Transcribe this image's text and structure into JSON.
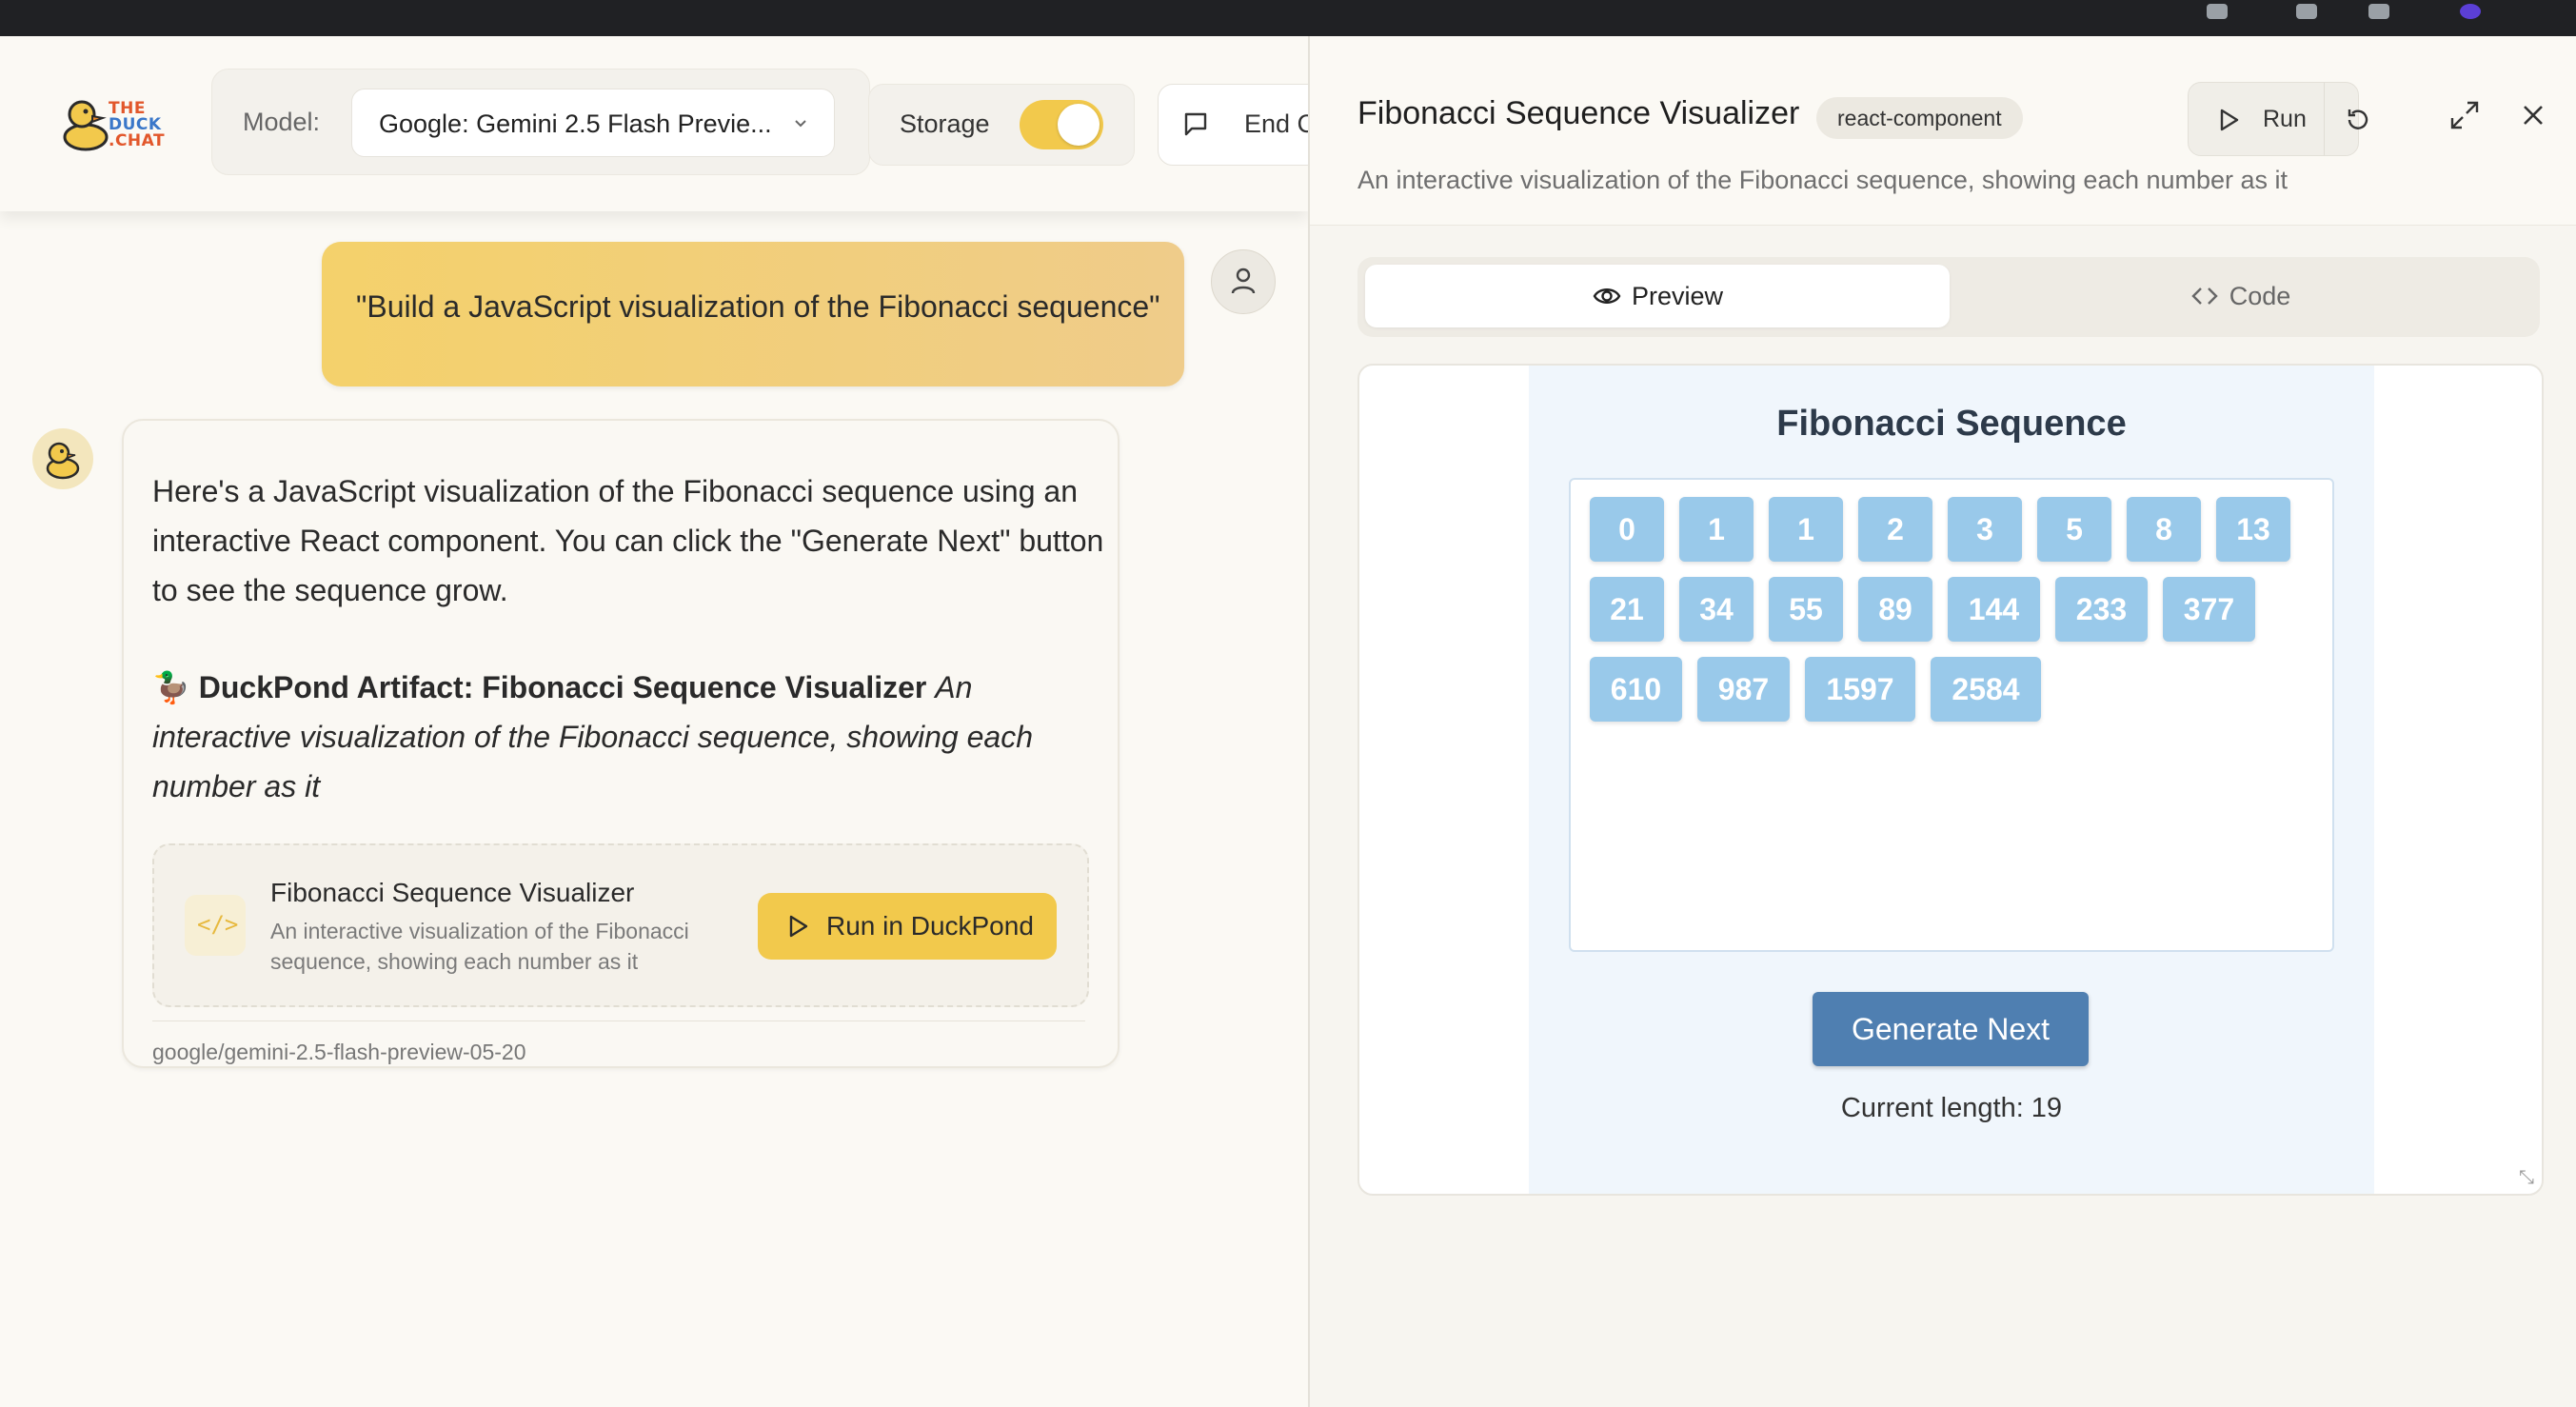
{
  "app": {
    "logo": {
      "line1": "THE",
      "line2": "DUCK",
      "line3": ".CHAT"
    },
    "model_label": "Model:",
    "model_value": "Google: Gemini 2.5 Flash Previe...",
    "storage_label": "Storage",
    "storage_on": true,
    "end_chat_label": "End C"
  },
  "chat": {
    "user_message": "\"Build a JavaScript visualization of the Fibonacci sequence\"",
    "assistant": {
      "intro": "Here's a JavaScript visualization of the Fibonacci sequence using an interactive React component. You can click the \"Generate Next\" button to see the sequence grow.",
      "artifact_emoji": "🦆",
      "artifact_heading": "DuckPond Artifact: Fibonacci Sequence Visualizer",
      "artifact_heading_desc": "An interactive visualization of the Fibonacci sequence, showing each number as it",
      "artifact_card": {
        "icon": "</>",
        "title": "Fibonacci Sequence Visualizer",
        "description": "An interactive visualization of the Fibonacci sequence, showing each number as it",
        "run_label": "Run in DuckPond"
      },
      "model_id": "google/gemini-2.5-flash-preview-05-20"
    }
  },
  "panel": {
    "title": "Fibonacci Sequence Visualizer",
    "badge": "react-component",
    "subtitle": "An interactive visualization of the Fibonacci sequence, showing each number as it",
    "run_label": "Run",
    "tabs": {
      "preview": "Preview",
      "code": "Code"
    },
    "active_tab": "preview"
  },
  "preview": {
    "title": "Fibonacci Sequence",
    "sequence": [
      "0",
      "1",
      "1",
      "2",
      "3",
      "5",
      "8",
      "13",
      "21",
      "34",
      "55",
      "89",
      "144",
      "233",
      "377",
      "610",
      "987",
      "1597",
      "2584"
    ],
    "generate_label": "Generate Next",
    "current_length": "Current length: 19"
  },
  "colors": {
    "accent_yellow": "#f2c94c",
    "number_tile": "#99c9ea",
    "generate_button": "#4f7fb1"
  }
}
